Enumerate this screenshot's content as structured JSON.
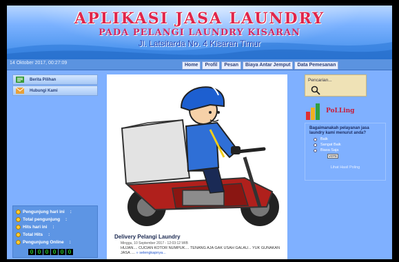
{
  "header": {
    "title": "APLIKASI JASA LAUNDRY",
    "subtitle": "PADA PELANGI LAUNDRY KISARAN",
    "address": "Jl. Latsitarda No. 4 Kisaran Timur"
  },
  "navbar": {
    "datetime": "14 Oktober 2017, 00:27:09",
    "items": [
      "Home",
      "Profil",
      "Pesan",
      "Biaya Antar Jemput",
      "Data Pemesanan"
    ]
  },
  "left_menu": {
    "items": [
      "Berita Pilihan",
      "Hubungi Kami"
    ]
  },
  "stats": {
    "rows": [
      "Pengunjung hari ini",
      "Total pengunjung",
      "Hits hari ini",
      "Total Hits",
      "Pengunjung Online"
    ],
    "separator": ":",
    "counter": [
      "0",
      "0",
      "0",
      "0",
      "0",
      "0"
    ]
  },
  "post": {
    "title": "Delivery Pelangi Laundry",
    "date": "Minggu, 10 September 2017 - 12:03:12 WIB",
    "body": "HUJAN.... CUCIAN KOTOR NUMPUK.... TENANG AJA GAK USAH GALAU... YUK GUNAKAN JASA .... ",
    "read_more": "» selengkapnya..."
  },
  "search": {
    "label": "Pencarian..."
  },
  "polling": {
    "logo_text": "PoLLing",
    "question": "Bagaimanakah pelayanan jasa laundry kami menurut anda?",
    "options": [
      "Baik",
      "Sangat Baik",
      "Biasa Saja"
    ],
    "vote_label": "VOTE",
    "result_link": "Lihat Hasil Poling"
  },
  "colors": {
    "page_bg": "#7fb0ff",
    "title_red": "#e0264a",
    "address_blue": "#1f3fb0"
  }
}
